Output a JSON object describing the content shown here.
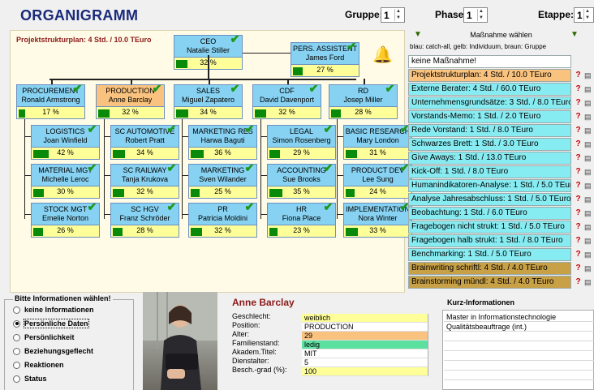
{
  "app": {
    "title": "ORGANIGRAMM"
  },
  "controls": {
    "gruppe_label": "Gruppe:",
    "gruppe_value": "1",
    "phase_label": "Phase:",
    "phase_value": "1",
    "etappe_label": "Etappe:",
    "etappe_value": "1"
  },
  "org": {
    "psp": "Projektstrukturplan: 4 Std. / 10.0 TEuro",
    "ceo": {
      "role": "CEO",
      "name": "Natalie Stiller",
      "pct": "32 %",
      "fill": 0.32
    },
    "assistant": {
      "role": "PERS. ASSISTENT",
      "name": "James Ford",
      "pct": "27 %",
      "fill": 0.27
    },
    "columns": [
      {
        "head": {
          "role": "PROCUREMENT",
          "name": "Ronald Armstrong",
          "pct": "17 %",
          "fill": 0.17
        },
        "subs": [
          {
            "role": "LOGISTICS",
            "name": "Joan Winfield",
            "pct": "42 %",
            "fill": 0.42
          },
          {
            "role": "MATERIAL MGT",
            "name": "Michelle Leroc",
            "pct": "30 %",
            "fill": 0.3
          },
          {
            "role": "STOCK MGT",
            "name": "Emelie Norton",
            "pct": "26 %",
            "fill": 0.26
          }
        ]
      },
      {
        "head": {
          "role": "PRODUCTION",
          "name": "Anne Barclay",
          "pct": "32 %",
          "fill": 0.32
        },
        "subs": [
          {
            "role": "SC AUTOMOTIVE",
            "name": "Robert Pratt",
            "pct": "34 %",
            "fill": 0.34
          },
          {
            "role": "SC RAILWAY",
            "name": "Tanja Krukova",
            "pct": "32 %",
            "fill": 0.32
          },
          {
            "role": "SC HGV",
            "name": "Franz Schröder",
            "pct": "28 %",
            "fill": 0.28
          }
        ]
      },
      {
        "head": {
          "role": "SALES",
          "name": "Miguel Zapatero",
          "pct": "34 %",
          "fill": 0.34
        },
        "subs": [
          {
            "role": "MARKETING RES",
            "name": "Harwa Baguti",
            "pct": "36 %",
            "fill": 0.36
          },
          {
            "role": "MARKETING",
            "name": "Sven Wilander",
            "pct": "25 %",
            "fill": 0.25
          },
          {
            "role": "PR",
            "name": "Patricia Moldini",
            "pct": "32 %",
            "fill": 0.32
          }
        ]
      },
      {
        "head": {
          "role": "CDF",
          "name": "David Davenport",
          "pct": "32 %",
          "fill": 0.32
        },
        "subs": [
          {
            "role": "LEGAL",
            "name": "Simon Rosenberg",
            "pct": "29 %",
            "fill": 0.29
          },
          {
            "role": "ACCOUNTING",
            "name": "Sue Brooks",
            "pct": "35 %",
            "fill": 0.35
          },
          {
            "role": "HR",
            "name": "Fiona Place",
            "pct": "23 %",
            "fill": 0.23
          }
        ]
      },
      {
        "head": {
          "role": "RD",
          "name": "Josep Miller",
          "pct": "28 %",
          "fill": 0.28
        },
        "subs": [
          {
            "role": "BASIC RESEARCH",
            "name": "Mary London",
            "pct": "31 %",
            "fill": 0.31
          },
          {
            "role": "PRODUCT DEV",
            "name": "Lee Sung",
            "pct": "24 %",
            "fill": 0.24
          },
          {
            "role": "IMPLEMENTATION",
            "name": "Nora Winter",
            "pct": "33 %",
            "fill": 0.33
          }
        ]
      }
    ]
  },
  "panel": {
    "title": "Maßnahme wählen",
    "subtitle": "blau: catch-all, gelb: Individuum, braun: Gruppe",
    "items": [
      {
        "label": "keine Maßnahme!",
        "color": "#ffffff"
      },
      {
        "label": "Projektstrukturplan:  4 Std. / 10.0 TEuro",
        "color": "#f9c27e"
      },
      {
        "label": "Externe Berater:  4 Std. / 60.0 TEuro",
        "color": "#87ecf2"
      },
      {
        "label": "Unternehmensgrundsätze:  3 Std. / 8.0 TEuro",
        "color": "#87ecf2"
      },
      {
        "label": "Vorstands-Memo:  1 Std. / 2.0 TEuro",
        "color": "#87ecf2"
      },
      {
        "label": "Rede Vorstand:  1 Std. / 8.0 TEuro",
        "color": "#87ecf2"
      },
      {
        "label": "Schwarzes Brett:  1 Std. / 3.0 TEuro",
        "color": "#87ecf2"
      },
      {
        "label": "Give Aways:  1 Std. / 13.0 TEuro",
        "color": "#87ecf2"
      },
      {
        "label": "Kick-Off:  1 Std. / 8.0 TEuro",
        "color": "#87ecf2"
      },
      {
        "label": "Humanindikatoren-Analyse:  1 Std. / 5.0 TEuro",
        "color": "#87ecf2"
      },
      {
        "label": "Analyse Jahresabschluss:  1 Std. / 5.0 TEuro",
        "color": "#87ecf2"
      },
      {
        "label": "Beobachtung:  1 Std. / 6.0 TEuro",
        "color": "#87ecf2"
      },
      {
        "label": "Fragebogen nicht strukt:  1 Std. / 5.0 TEuro",
        "color": "#87ecf2"
      },
      {
        "label": "Fragebogen halb strukt:  1 Std. / 8.0 TEuro",
        "color": "#87ecf2"
      },
      {
        "label": "Benchmarking:  1 Std. / 5.0 TEuro",
        "color": "#87ecf2"
      },
      {
        "label": "Brainwriting schriftl:  4 Std. / 4.0 TEuro",
        "color": "#c8a046"
      },
      {
        "label": "Brainstorming mündl:  4 Std. / 4.0 TEuro",
        "color": "#c8a046"
      }
    ]
  },
  "info": {
    "group_title": "Bitte Informationen wählen!",
    "options": [
      "keine Informationen",
      "Persönliche Daten",
      "Persönlichkeit",
      "Beziehungsgeflecht",
      "Reaktionen",
      "Status"
    ],
    "selected": 1
  },
  "person": {
    "name": "Anne Barclay",
    "fields": [
      {
        "label": "Geschlecht:",
        "value": "weiblich",
        "color": "#ffff99"
      },
      {
        "label": "Position:",
        "value": "PRODUCTION",
        "color": "#ffffff"
      },
      {
        "label": "Alter:",
        "value": "29",
        "color": "#f9c27e"
      },
      {
        "label": "Familienstand:",
        "value": "ledig",
        "color": "#5ce0a0"
      },
      {
        "label": "Akadem.Titel:",
        "value": "MIT",
        "color": "#ffffff"
      },
      {
        "label": "Dienstalter:",
        "value": "5",
        "color": "#ffffff"
      },
      {
        "label": "Besch.-grad (%):",
        "value": "100",
        "color": "#ffff99"
      }
    ]
  },
  "kurz": {
    "title": "Kurz-Informationen",
    "lines": [
      "Master in Informationstechnologie",
      "Qualitätsbeauftrage (int.)",
      "",
      "",
      "",
      "",
      ""
    ]
  }
}
